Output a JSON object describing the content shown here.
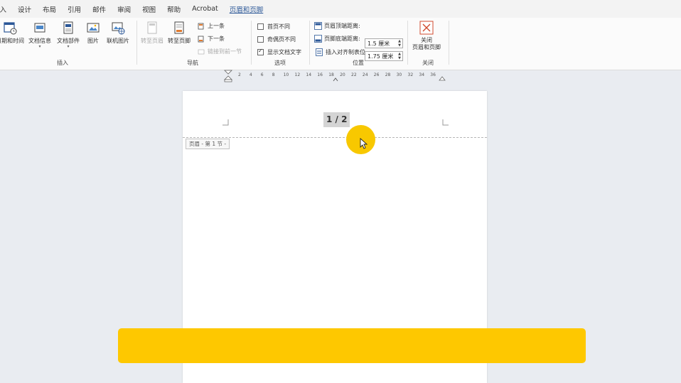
{
  "menubar": {
    "tabs": [
      "插入",
      "设计",
      "布局",
      "引用",
      "邮件",
      "审阅",
      "视图",
      "帮助",
      "Acrobat",
      "页眉和页脚"
    ]
  },
  "ribbon": {
    "insert_group": {
      "label": "插入",
      "buttons": [
        {
          "label": "日期和时间"
        },
        {
          "label": "文档信息"
        },
        {
          "label": "文档部件"
        },
        {
          "label": "图片"
        },
        {
          "label": "联机图片"
        }
      ]
    },
    "nav_group": {
      "label": "导航",
      "goto_header": "转至页眉",
      "goto_footer": "转至页脚",
      "prev": "上一条",
      "next": "下一条",
      "link_prev": "链接到前一节"
    },
    "options_group": {
      "label": "选项",
      "first_page_diff": "首页不同",
      "odd_even_diff": "奇偶页不同",
      "show_doc_text": "显示文档文字"
    },
    "position_group": {
      "label": "位置",
      "header_from_top_label": "页眉顶端距离:",
      "header_from_top_value": "1.5 厘米",
      "footer_from_bottom_label": "页脚底端距离:",
      "footer_from_bottom_value": "1.75 厘米",
      "insert_align_tab": "插入对齐制表位"
    },
    "close_group": {
      "label": "关闭",
      "close_button": "关闭\n页眉和页脚"
    }
  },
  "ruler": {
    "ticks": [
      "2",
      "4",
      "6",
      "8",
      "10",
      "12",
      "14",
      "16",
      "18",
      "20",
      "22",
      "24",
      "26",
      "28",
      "30",
      "32",
      "34",
      "36"
    ]
  },
  "document": {
    "page_number": "1 / 2",
    "header_tag": "页眉 - 第 1 节 -"
  },
  "colors": {
    "accent": "#2b5797",
    "highlight": "#f8c800",
    "caption_bar": "#fec800"
  }
}
